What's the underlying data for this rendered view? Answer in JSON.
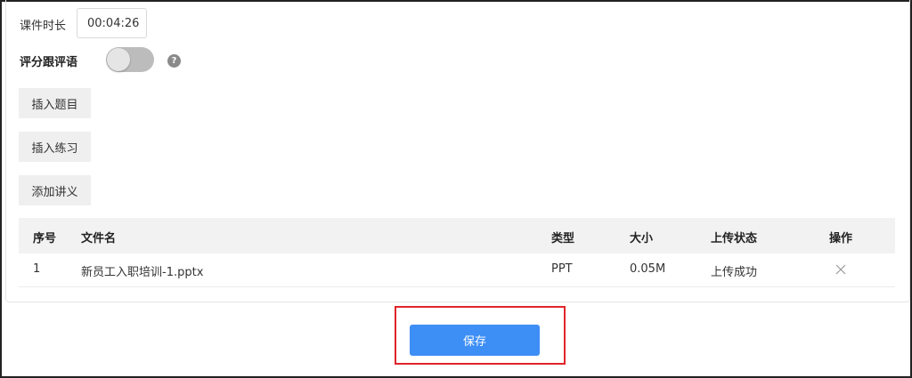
{
  "form": {
    "duration_label": "课件时长",
    "duration_value": "00:04:26",
    "score_label": "评分跟评语",
    "score_toggle_on": false,
    "help_icon_glyph": "?",
    "insert_question_label": "插入题目",
    "insert_exercise_label": "插入练习",
    "add_handout_label": "添加讲义"
  },
  "table": {
    "headers": {
      "no": "序号",
      "name": "文件名",
      "type": "类型",
      "size": "大小",
      "status": "上传状态",
      "actions": "操作"
    },
    "rows": [
      {
        "no": "1",
        "name": "新员工入职培训-1.pptx",
        "type": "PPT",
        "size": "0.05M",
        "status": "上传成功",
        "action_icon": "close-icon"
      }
    ]
  },
  "footer": {
    "save_label": "保存"
  },
  "colors": {
    "primary": "#3d8ef5",
    "highlight": "#e0242b",
    "toggle_off": "#bcbcbc"
  }
}
